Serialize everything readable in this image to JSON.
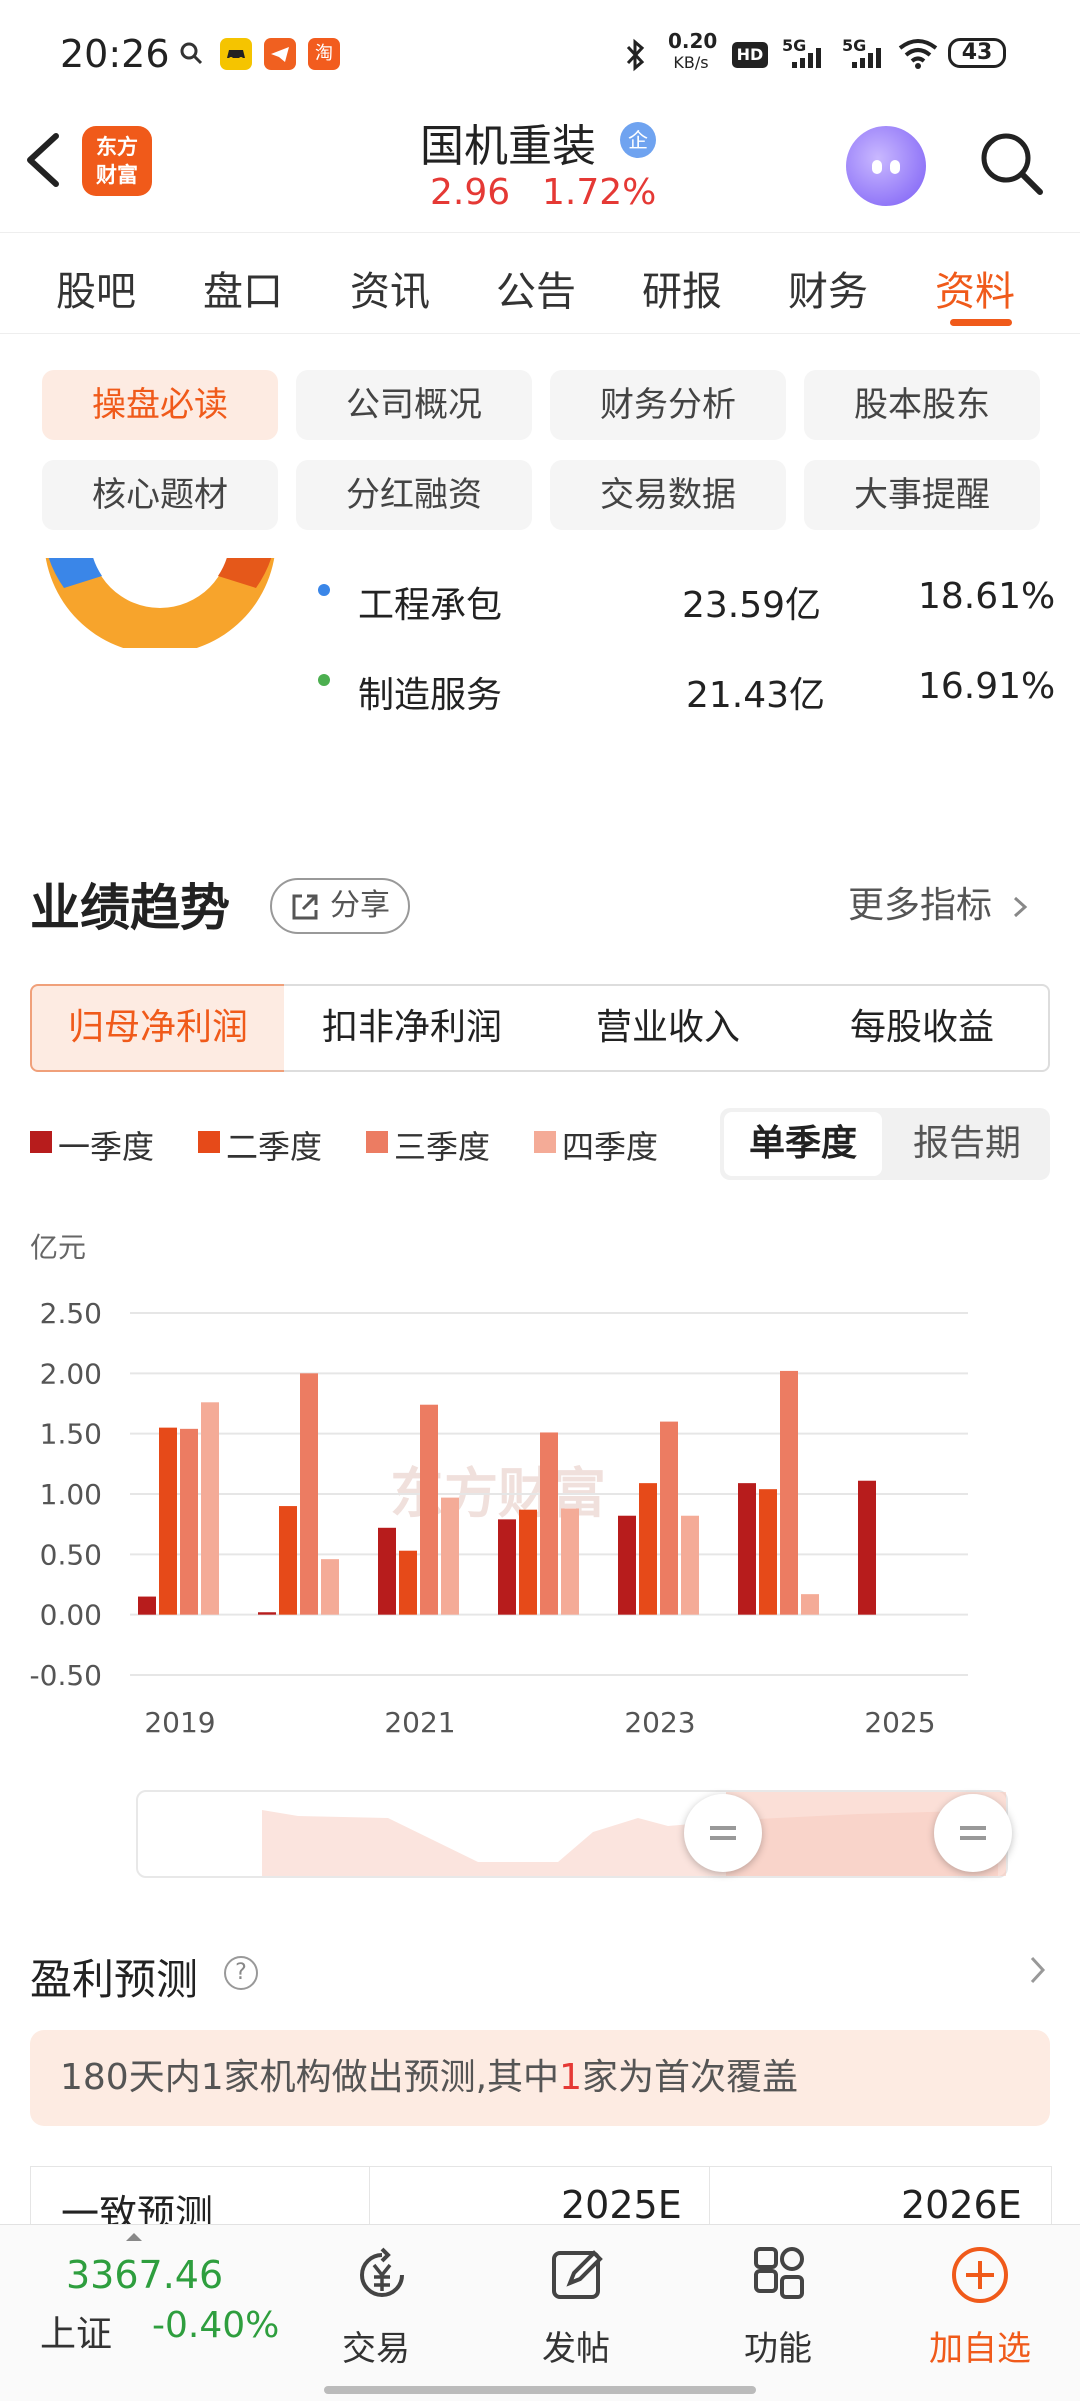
{
  "status_bar": {
    "time": "20:26",
    "net_speed_value": "0.20",
    "net_speed_unit": "KB/s",
    "hd": "HD",
    "signal1": "5G",
    "signal2": "5G",
    "battery": "43",
    "app_icons": [
      "search-icon",
      "car-icon",
      "telegram-icon",
      "taobao-icon"
    ],
    "taobao": "淘"
  },
  "header": {
    "logo_line1": "东方",
    "logo_line2": "财富",
    "stock_name": "国机重装",
    "badge": "企",
    "price": "2.96",
    "change_pct": "1.72%"
  },
  "tabs": [
    "股吧",
    "盘口",
    "资讯",
    "公告",
    "研报",
    "财务",
    "资料"
  ],
  "active_tab": "资料",
  "sub_tabs": [
    "操盘必读",
    "公司概况",
    "财务分析",
    "股本股东",
    "核心题材",
    "分红融资",
    "交易数据",
    "大事提醒"
  ],
  "business": [
    {
      "name": "工程承包",
      "amount": "23.59亿",
      "pct": "18.61%",
      "color": "#3a86e8"
    },
    {
      "name": "制造服务",
      "amount": "21.43亿",
      "pct": "16.91%",
      "color": "#4caf50"
    }
  ],
  "performance": {
    "title": "业绩趋势",
    "share": "分享",
    "more": "更多指标",
    "segments": [
      "归母净利润",
      "扣非净利润",
      "营业收入",
      "每股收益"
    ],
    "legend": [
      "一季度",
      "二季度",
      "三季度",
      "四季度"
    ],
    "legend_colors": [
      "#b71c1c",
      "#e64a19",
      "#ec7c62",
      "#f4ab97"
    ],
    "toggle_on": "单季度",
    "toggle_off": "报告期",
    "unit": "亿元",
    "watermark": "东方财富"
  },
  "chart_data": {
    "type": "bar",
    "ylabel": "亿元",
    "ylim": [
      -0.5,
      2.5
    ],
    "yticks": [
      "2.50",
      "2.00",
      "1.50",
      "1.00",
      "0.50",
      "0.00",
      "-0.50"
    ],
    "xticks": [
      "2019",
      "2021",
      "2023",
      "2025"
    ],
    "categories": [
      "2019",
      "2020",
      "2021",
      "2022",
      "2023",
      "2024",
      "2025"
    ],
    "series": [
      {
        "name": "一季度",
        "values": [
          0.15,
          0.02,
          0.72,
          0.79,
          0.82,
          1.09,
          1.11
        ]
      },
      {
        "name": "二季度",
        "values": [
          1.55,
          0.9,
          0.53,
          0.87,
          1.09,
          1.04,
          null
        ]
      },
      {
        "name": "三季度",
        "values": [
          1.54,
          2.0,
          1.74,
          1.51,
          1.6,
          2.02,
          null
        ]
      },
      {
        "name": "四季度",
        "values": [
          1.76,
          0.46,
          0.97,
          0.88,
          0.82,
          0.17,
          null
        ]
      }
    ]
  },
  "forecast": {
    "title": "盈利预测",
    "notice_a": "180天内1家机构做出预测,其中",
    "notice_num": "1",
    "notice_b": "家为首次覆盖",
    "col0": "一致预测",
    "col1": "2025E",
    "col2": "2026E"
  },
  "bottom_bar": {
    "index_value": "3367.46",
    "index_name": "上证",
    "index_change": "-0.40%",
    "items": [
      "交易",
      "发帖",
      "功能",
      "加自选"
    ]
  }
}
